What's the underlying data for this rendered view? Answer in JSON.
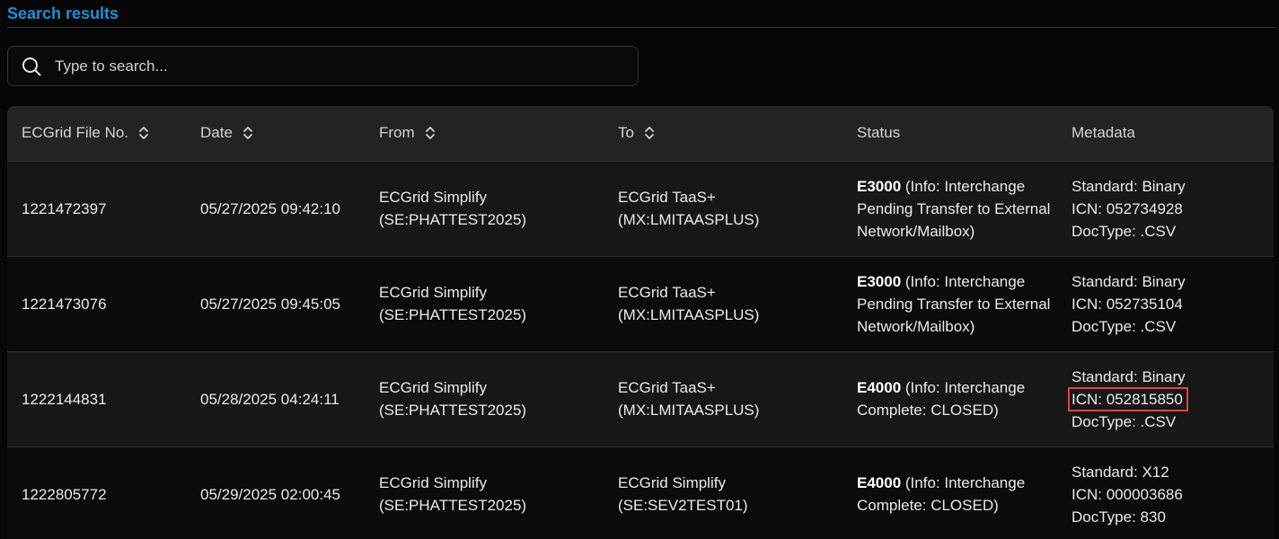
{
  "header": {
    "title": "Search results"
  },
  "search": {
    "placeholder": "Type to search..."
  },
  "table": {
    "columns": [
      "ECGrid File No.",
      "Date",
      "From",
      "To",
      "Status",
      "Metadata"
    ],
    "rows": [
      {
        "file_no": "1221472397",
        "date": "05/27/2025 09:42:10",
        "from_line1": "ECGrid Simplify",
        "from_line2": "(SE:PHATTEST2025)",
        "to_line1": "ECGrid TaaS+",
        "to_line2": "(MX:LMITAASPLUS)",
        "status_code": "E3000",
        "status_text": " (Info: Interchange Pending Transfer to External Network/Mailbox)",
        "meta_standard": "Standard: Binary",
        "meta_icn": "ICN: 052734928",
        "meta_doctype": "DocType: .CSV"
      },
      {
        "file_no": "1221473076",
        "date": "05/27/2025 09:45:05",
        "from_line1": "ECGrid Simplify",
        "from_line2": "(SE:PHATTEST2025)",
        "to_line1": "ECGrid TaaS+",
        "to_line2": "(MX:LMITAASPLUS)",
        "status_code": "E3000",
        "status_text": " (Info: Interchange Pending Transfer to External Network/Mailbox)",
        "meta_standard": "Standard: Binary",
        "meta_icn": "ICN: 052735104",
        "meta_doctype": "DocType: .CSV"
      },
      {
        "file_no": "1222144831",
        "date": "05/28/2025 04:24:11",
        "from_line1": "ECGrid Simplify",
        "from_line2": "(SE:PHATTEST2025)",
        "to_line1": "ECGrid TaaS+",
        "to_line2": "(MX:LMITAASPLUS)",
        "status_code": "E4000",
        "status_text": " (Info: Interchange Complete: CLOSED)",
        "meta_standard": "Standard: Binary",
        "meta_icn": "ICN: 052815850",
        "meta_doctype": "DocType: .CSV"
      },
      {
        "file_no": "1222805772",
        "date": "05/29/2025 02:00:45",
        "from_line1": "ECGrid Simplify",
        "from_line2": "(SE:PHATTEST2025)",
        "to_line1": "ECGrid Simplify",
        "to_line2": "(SE:SEV2TEST01)",
        "status_code": "E4000",
        "status_text": " (Info: Interchange Complete: CLOSED)",
        "meta_standard": "Standard: X12",
        "meta_icn": "ICN: 000003686",
        "meta_doctype": "DocType: 830"
      }
    ]
  },
  "colors": {
    "accent": "#1f8fd6",
    "highlight": "#e0453c"
  },
  "icons": {
    "search": "search-icon",
    "sort": "sort-icon"
  }
}
